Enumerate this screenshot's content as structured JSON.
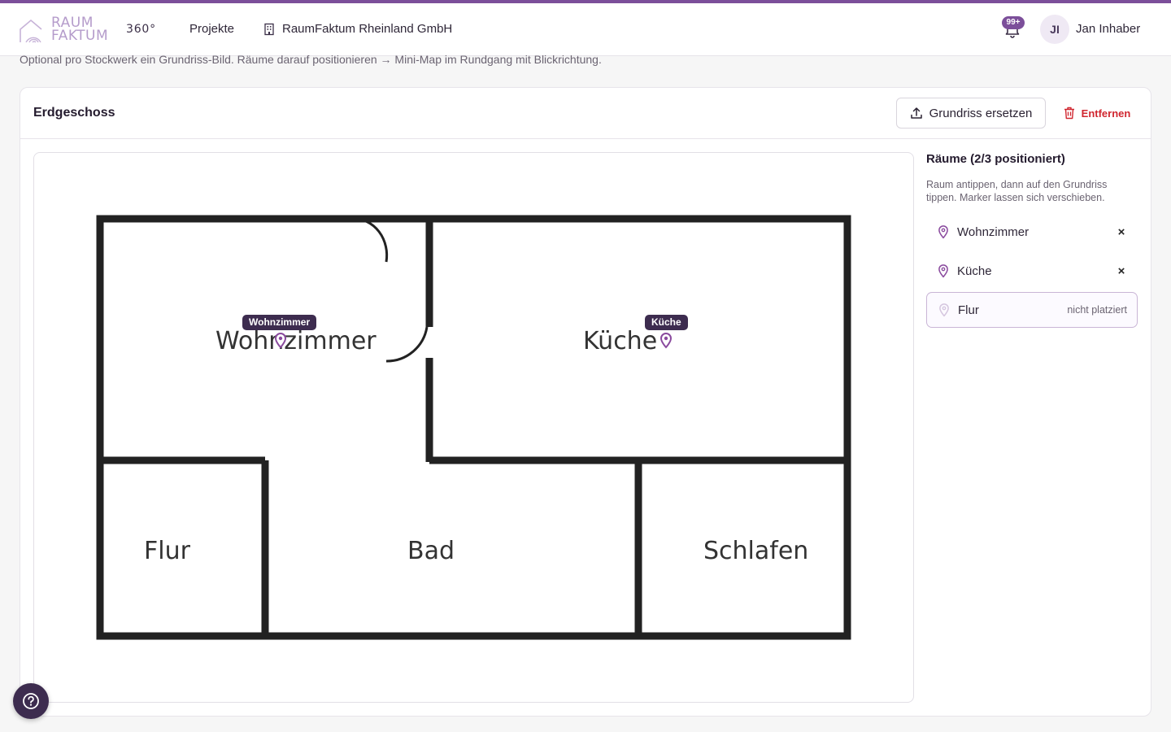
{
  "nav": {
    "logo_line1": "RAUM",
    "logo_line2": "FAKTUM",
    "product": "360°",
    "projects_link": "Projekte",
    "company": "RaumFaktum Rheinland GmbH",
    "notifications_badge": "99+",
    "avatar_initials": "JI",
    "user_name": "Jan Inhaber",
    "accent_color": "#7c4f9a"
  },
  "page": {
    "subtitle": "Optional pro Stockwerk ein Grundriss-Bild. Räume darauf positionieren → Mini-Map im Rundgang mit Blickrichtung."
  },
  "floor": {
    "title": "Erdgeschoss",
    "replace_button": "Grundriss ersetzen",
    "remove_button": "Entfernen",
    "plan_labels": {
      "wohnzimmer": "Wohnzimmer",
      "kueche": "Küche",
      "flur": "Flur",
      "bad": "Bad",
      "schlafen": "Schlafen"
    },
    "markers": {
      "wohnzimmer": "Wohnzimmer",
      "kueche": "Küche"
    }
  },
  "rooms_panel": {
    "title": "Räume (2/3 positioniert)",
    "hint": "Raum antippen, dann auf den Grundriss tippen. Marker lassen sich verschieben.",
    "items": [
      {
        "name": "Wohnzimmer",
        "placed": true,
        "action": "×"
      },
      {
        "name": "Küche",
        "placed": true,
        "action": "×"
      },
      {
        "name": "Flur",
        "placed": false,
        "status": "nicht platziert"
      }
    ]
  }
}
